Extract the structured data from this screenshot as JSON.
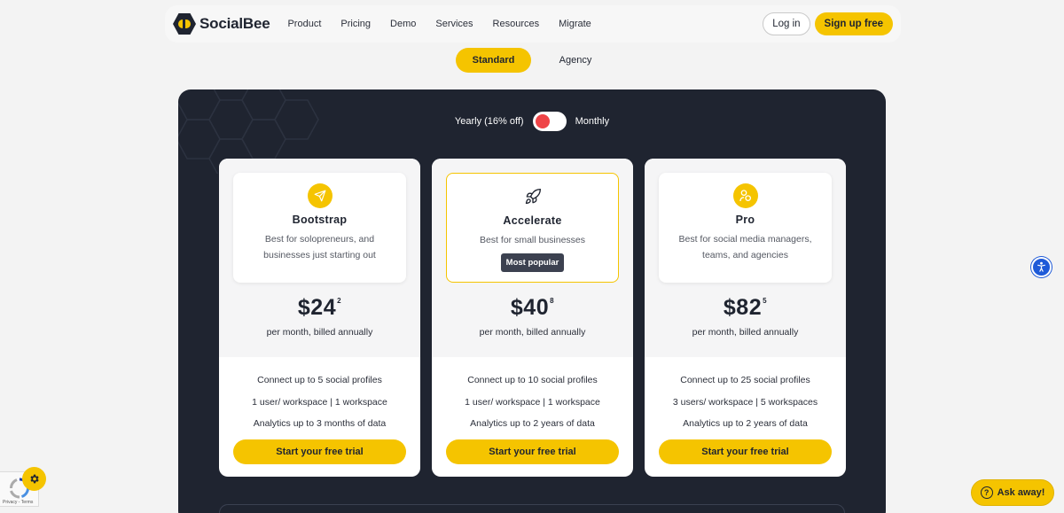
{
  "brand": {
    "name": "SocialBee"
  },
  "nav": {
    "items": [
      {
        "label": "Product"
      },
      {
        "label": "Pricing"
      },
      {
        "label": "Demo"
      },
      {
        "label": "Services"
      },
      {
        "label": "Resources"
      },
      {
        "label": "Migrate"
      }
    ],
    "login_label": "Log in",
    "signup_label": "Sign up free"
  },
  "plan_type": {
    "standard": "Standard",
    "agency": "Agency",
    "selected": "Standard"
  },
  "billing": {
    "yearly_label": "Yearly (16% off)",
    "monthly_label": "Monthly",
    "selected": "Yearly"
  },
  "plans": [
    {
      "name": "Bootstrap",
      "description": "Best for solopreneurs, and businesses just starting out",
      "icon": "paper-plane-icon",
      "price_main": "$24",
      "price_cents": "2",
      "price_note": "per month, billed annually",
      "features": [
        "Connect up to 5 social profiles",
        "1 user/ workspace | 1 workspace",
        "Analytics up to 3 months of data"
      ],
      "cta": "Start your free trial"
    },
    {
      "name": "Accelerate",
      "description": "Best for small businesses",
      "badge": "Most popular",
      "icon": "rocket-icon",
      "price_main": "$40",
      "price_cents": "8",
      "price_note": "per month, billed annually",
      "features": [
        "Connect up to 10 social profiles",
        "1 user/ workspace | 1 workspace",
        "Analytics up to 2 years of data"
      ],
      "cta": "Start your free trial"
    },
    {
      "name": "Pro",
      "description": "Best for social media managers, teams, and agencies",
      "icon": "users-icon",
      "price_main": "$82",
      "price_cents": "5",
      "price_note": "per month, billed annually",
      "features": [
        "Connect up to 25 social profiles",
        "3 users/ workspace | 5 workspaces",
        "Analytics up to 2 years of data"
      ],
      "cta": "Start your free trial"
    }
  ],
  "widgets": {
    "ask_label": "Ask away!",
    "recaptcha_text": "Privacy - Terms"
  },
  "colors": {
    "accent": "#f5c400",
    "panel": "#1f2430",
    "toggle_knob": "#ef4447",
    "a11y": "#1e5ad8"
  }
}
